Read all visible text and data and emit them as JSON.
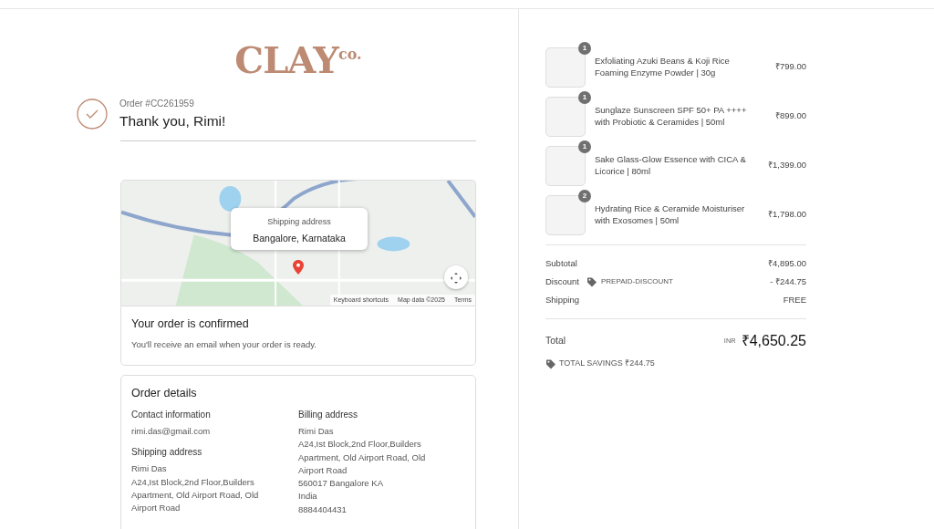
{
  "logo": {
    "main": "CLAY",
    "suffix": "co."
  },
  "order": {
    "number": "Order #CC261959",
    "greeting": "Thank you, Rimi!"
  },
  "map": {
    "popup_label": "Shipping address",
    "popup_value": "Bangalore, Karnataka",
    "attribution": [
      "Keyboard shortcuts",
      "Map data ©2025",
      "Terms"
    ]
  },
  "confirmation": {
    "title": "Your order is confirmed",
    "message": "You'll receive an email when your order is ready."
  },
  "order_details": {
    "title": "Order details",
    "columns": [
      [
        {
          "heading": "Contact information",
          "lines": [
            "rimi.das@gmail.com"
          ]
        },
        {
          "heading": "Shipping address",
          "lines": [
            "Rimi Das",
            "A24,Ist Block,2nd Floor,Builders Apartment, Old Airport Road, Old Airport Road"
          ]
        }
      ],
      [
        {
          "heading": "Billing address",
          "lines": [
            "Rimi Das",
            "A24,Ist Block,2nd Floor,Builders Apartment, Old Airport Road, Old Airport Road",
            "560017 Bangalore KA",
            "India",
            "8884404431"
          ]
        }
      ]
    ]
  },
  "items": [
    {
      "name": "Exfoliating Azuki Beans & Koji Rice Foaming Enzyme Powder | 30g",
      "quantity": "1",
      "price": "₹799.00"
    },
    {
      "name": "Sunglaze Sunscreen SPF 50+ PA ++++ with Probiotic & Ceramides | 50ml",
      "quantity": "1",
      "price": "₹899.00"
    },
    {
      "name": "Sake Glass-Glow Essence with CICA & Licorice | 80ml",
      "quantity": "1",
      "price": "₹1,399.00"
    },
    {
      "name": "Hydrating Rice & Ceramide Moisturiser with Exosomes | 50ml",
      "quantity": "2",
      "price": "₹1,798.00"
    }
  ],
  "summary": [
    {
      "label": "Subtotal",
      "value": "₹4,895.00"
    },
    {
      "label": "Discount",
      "code": "PREPAID-DISCOUNT",
      "value": "- ₹244.75"
    },
    {
      "label": "Shipping",
      "value": "FREE"
    }
  ],
  "total": {
    "label": "Total",
    "currency": "INR",
    "amount": "₹4,650.25",
    "savings": "TOTAL SAVINGS ₹244.75"
  }
}
